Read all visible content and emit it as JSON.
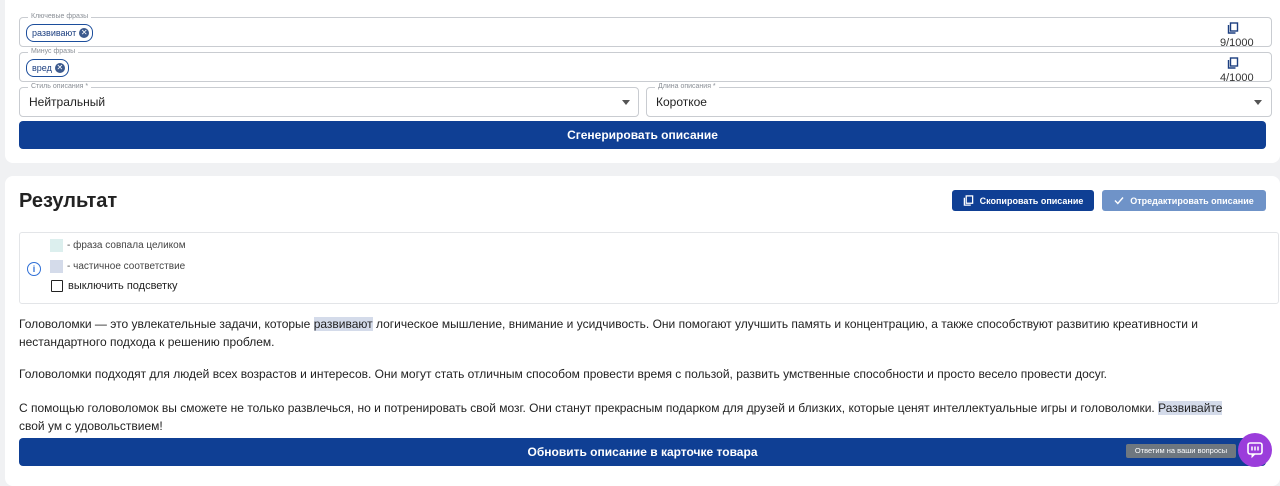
{
  "form": {
    "keywords": {
      "label": "Ключевые фразы",
      "chip": "развивают",
      "counter": "9/1000"
    },
    "minus": {
      "label": "Минус фразы",
      "chip": "вред",
      "counter": "4/1000"
    },
    "style": {
      "label": "Стиль описания *",
      "value": "Нейтральный"
    },
    "length": {
      "label": "Длина описания *",
      "value": "Короткое"
    },
    "generate_label": "Сгенерировать описание"
  },
  "result": {
    "title": "Результат",
    "copy_label": "Скопировать описание",
    "edit_label": "Отредактировать описание",
    "legend": {
      "full_match": "- фраза совпала целиком",
      "partial_match": "- частичное соответствие",
      "disable_highlight": "выключить подсветку",
      "full_color": "#dcefee",
      "partial_color": "#d4dbea"
    },
    "p1_a": "Головоломки — это увлекательные задачи, которые ",
    "p1_hl": "развивают",
    "p1_b": " логическое мышление, внимание и усидчивость. Они помогают улучшить память и концентрацию, а также способствуют развитию креативности и нестандартного подхода к решению проблем.",
    "p2": "Головоломки подходят для людей всех возрастов и интересов. Они могут стать отличным способом провести время с пользой, развить умственные способности и просто весело провести досуг.",
    "p3_a": "С помощью головоломок вы сможете не только развлечься, но и потренировать свой мозг. Они станут прекрасным подарком для друзей и близких, которые ценят интеллектуальные игры и головоломки. ",
    "p3_hl": "Развивайте",
    "p3_b": " свой ум с удовольствием!",
    "update_label": "Обновить описание в карточке товара"
  },
  "chat": {
    "tooltip": "Ответим на ваши вопросы"
  },
  "colors": {
    "primary": "#0f3f94",
    "edit_disabled": "#6f93c8",
    "chat": "#9b3ddb"
  }
}
